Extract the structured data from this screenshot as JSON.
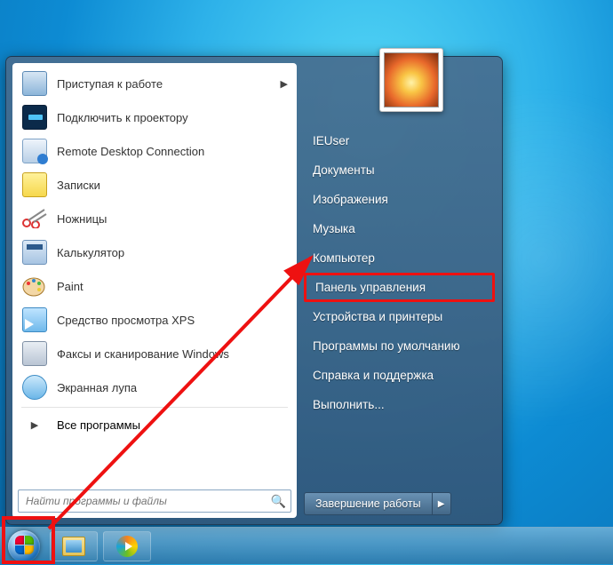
{
  "left_programs": [
    {
      "label": "Приступая к работе",
      "has_submenu": true
    },
    {
      "label": "Подключить к проектору",
      "has_submenu": false
    },
    {
      "label": "Remote Desktop Connection",
      "has_submenu": false
    },
    {
      "label": "Записки",
      "has_submenu": false
    },
    {
      "label": "Ножницы",
      "has_submenu": false
    },
    {
      "label": "Калькулятор",
      "has_submenu": false
    },
    {
      "label": "Paint",
      "has_submenu": false
    },
    {
      "label": "Средство просмотра XPS",
      "has_submenu": false
    },
    {
      "label": "Факсы и сканирование Windows",
      "has_submenu": false
    },
    {
      "label": "Экранная лупа",
      "has_submenu": false
    }
  ],
  "all_programs_label": "Все программы",
  "search": {
    "placeholder": "Найти программы и файлы"
  },
  "right_items": [
    "IEUser",
    "Документы",
    "Изображения",
    "Музыка",
    "Компьютер",
    "Панель управления",
    "Устройства и принтеры",
    "Программы по умолчанию",
    "Справка и поддержка",
    "Выполнить..."
  ],
  "highlighted_right_index": 5,
  "shutdown_label": "Завершение работы"
}
